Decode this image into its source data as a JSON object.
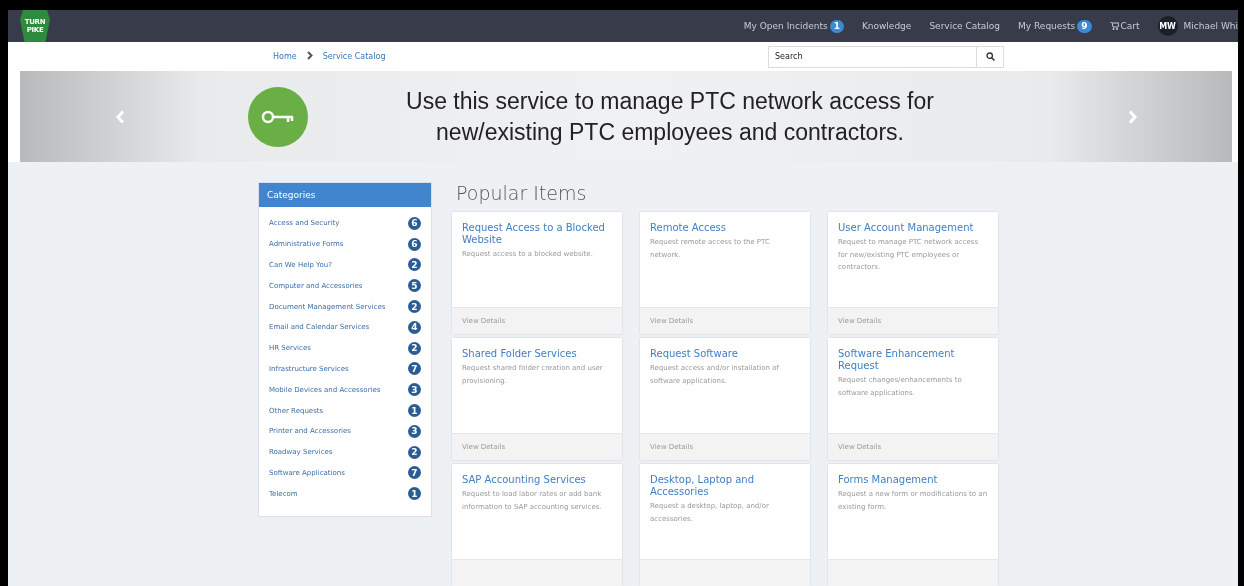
{
  "header": {
    "logo": {
      "top": "TURN",
      "bottom": "PIKE"
    },
    "nav": [
      {
        "label": "My Open Incidents",
        "badge": "1"
      },
      {
        "label": "Knowledge"
      },
      {
        "label": "Service Catalog"
      },
      {
        "label": "My Requests",
        "badge": "9"
      },
      {
        "label": "Cart",
        "kind": "cart"
      }
    ],
    "user": {
      "initials": "MW",
      "name": "Michael Whi"
    }
  },
  "breadcrumb": [
    "Home",
    "Service Catalog"
  ],
  "search": {
    "placeholder": "Search"
  },
  "banner": {
    "text": "Use this service to manage PTC network access for new/existing PTC employees and contractors."
  },
  "categories": {
    "title": "Categories",
    "items": [
      {
        "label": "Access and Security",
        "count": "6"
      },
      {
        "label": "Administrative Forms",
        "count": "6"
      },
      {
        "label": "Can We Help You?",
        "count": "2"
      },
      {
        "label": "Computer and Accessories",
        "count": "5"
      },
      {
        "label": "Document Management Services",
        "count": "2"
      },
      {
        "label": "Email and Calendar Services",
        "count": "4"
      },
      {
        "label": "HR Services",
        "count": "2"
      },
      {
        "label": "Infrastructure Services",
        "count": "7"
      },
      {
        "label": "Mobile Devices and Accessories",
        "count": "3"
      },
      {
        "label": "Other Requests",
        "count": "1"
      },
      {
        "label": "Printer and Accessories",
        "count": "3"
      },
      {
        "label": "Roadway Services",
        "count": "2"
      },
      {
        "label": "Software Applications",
        "count": "7"
      },
      {
        "label": "Telecom",
        "count": "1"
      }
    ]
  },
  "popular": {
    "title": "Popular Items",
    "items": [
      {
        "title": "Request Access to a Blocked Website",
        "description": "Request access to a blocked website.",
        "link": "View Details"
      },
      {
        "title": "Remote Access",
        "description": "Request remote access to the PTC network.",
        "link": "View Details"
      },
      {
        "title": "User Account Management",
        "description": "Request to manage PTC network access for new/existing PTC employees or contractors.",
        "link": "View Details"
      },
      {
        "title": "Shared Folder Services",
        "description": "Request shared folder creation and user provisioning.",
        "link": "View Details"
      },
      {
        "title": "Request Software",
        "description": "Request access and/or installation of software applications.",
        "link": "View Details"
      },
      {
        "title": "Software Enhancement Request",
        "description": "Request changes/enhancements to software applications.",
        "link": "View Details"
      },
      {
        "title": "SAP Accounting Services",
        "description": "Request to load labor rates or add bank information to SAP accounting services."
      },
      {
        "title": "Desktop, Laptop and Accessories",
        "description": "Request a desktop, laptop, and/or accessories."
      },
      {
        "title": "Forms Management",
        "description": "Request a new form or modifications to an existing form."
      }
    ]
  }
}
